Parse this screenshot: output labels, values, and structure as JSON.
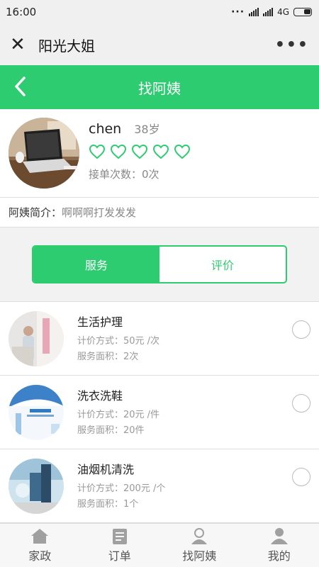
{
  "status_bar": {
    "time": "16:00",
    "network": "4G"
  },
  "app_bar": {
    "close_symbol": "✕",
    "title": "阳光大姐",
    "more_symbol": "•••"
  },
  "nav": {
    "title": "找阿姨"
  },
  "profile": {
    "name": "chen",
    "age": "38岁",
    "rating_hearts": 5,
    "orders_label": "接单次数：",
    "orders_value": "0次"
  },
  "intro": {
    "label": "阿姨简介：",
    "text": "啊啊啊打发发发"
  },
  "tabs": [
    {
      "label": "服务",
      "active": true
    },
    {
      "label": "评价",
      "active": false
    }
  ],
  "services": [
    {
      "name": "生活护理",
      "price_line": "计价方式：50元 /次",
      "area_line": "服务面积：2次"
    },
    {
      "name": "洗衣洗鞋",
      "price_line": "计价方式：20元 /件",
      "area_line": "服务面积：20件"
    },
    {
      "name": "油烟机清洗",
      "price_line": "计价方式：200元 /个",
      "area_line": "服务面积：1个"
    }
  ],
  "tabbar": [
    {
      "label": "家政",
      "icon": "house-icon"
    },
    {
      "label": "订单",
      "icon": "clipboard-icon"
    },
    {
      "label": "找阿姨",
      "icon": "person-search-icon"
    },
    {
      "label": "我的",
      "icon": "user-icon"
    }
  ],
  "colors": {
    "accent": "#2ecc71",
    "icon_gray": "#a0a0a0"
  }
}
